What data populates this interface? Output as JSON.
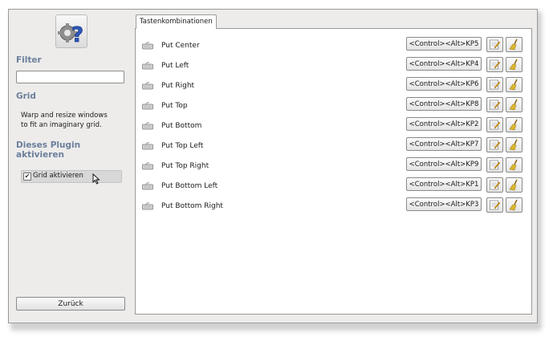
{
  "sidebar": {
    "plugin_icon": "gear-question-icon",
    "filter_heading": "Filter",
    "filter_value": "",
    "plugin_name": "Grid",
    "plugin_description": "Warp and resize windows\nto fit an imaginary grid.",
    "enable_heading_line1": "Dieses Plugin",
    "enable_heading_line2": "aktivieren",
    "enable_checkbox_label": "Grid aktivieren",
    "enable_checked": true,
    "back_button": "Zurück"
  },
  "notebook": {
    "tab_label": "Tastenkombinationen"
  },
  "bindings": [
    {
      "label": "Put Center",
      "shortcut": "<Control><Alt>KP5"
    },
    {
      "label": "Put Left",
      "shortcut": "<Control><Alt>KP4"
    },
    {
      "label": "Put Right",
      "shortcut": "<Control><Alt>KP6"
    },
    {
      "label": "Put Top",
      "shortcut": "<Control><Alt>KP8"
    },
    {
      "label": "Put Bottom",
      "shortcut": "<Control><Alt>KP2"
    },
    {
      "label": "Put Top Left",
      "shortcut": "<Control><Alt>KP7"
    },
    {
      "label": "Put Top Right",
      "shortcut": "<Control><Alt>KP9"
    },
    {
      "label": "Put Bottom Left",
      "shortcut": "<Control><Alt>KP1"
    },
    {
      "label": "Put Bottom Right",
      "shortcut": "<Control><Alt>KP3"
    }
  ],
  "icons": {
    "row_icon": "keyboard-icon",
    "edit_icon": "edit-icon",
    "clear_icon": "broom-icon"
  },
  "colors": {
    "heading": "#6b7f9c",
    "window_bg": "#edeceb",
    "panel_bg": "#ffffff"
  }
}
